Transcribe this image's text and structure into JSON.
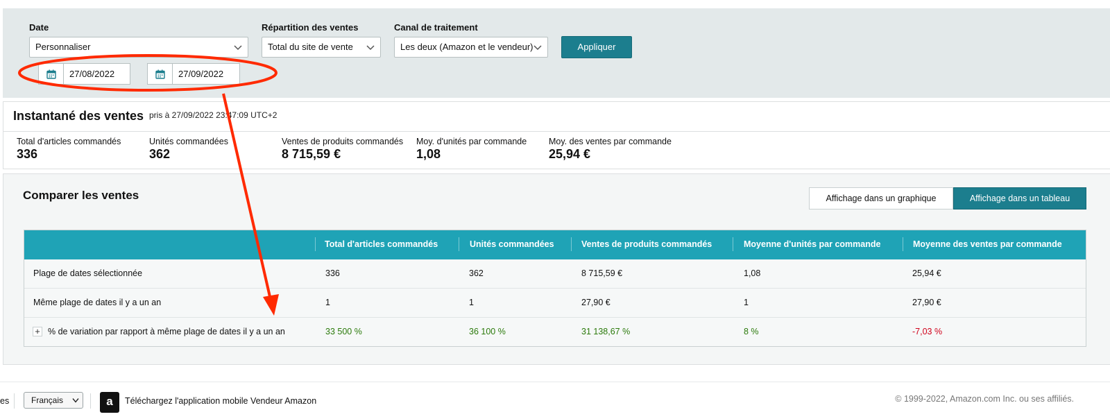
{
  "filters": {
    "date_label": "Date",
    "date_value": "Personnaliser",
    "repartition_label": "Répartition des ventes",
    "repartition_value": "Total du site de vente",
    "canal_label": "Canal de traitement",
    "canal_value": "Les deux (Amazon et le vendeur)",
    "apply_label": "Appliquer",
    "start_date": "27/08/2022",
    "end_date": "27/09/2022"
  },
  "snapshot": {
    "title": "Instantané des ventes",
    "timestamp": "pris à 27/09/2022 23:47:09 UTC+2",
    "metrics": [
      {
        "label": "Total d'articles commandés",
        "value": "336"
      },
      {
        "label": "Unités commandées",
        "value": "362"
      },
      {
        "label": "Ventes de produits commandés",
        "value": "8 715,59 €"
      },
      {
        "label": "Moy. d'unités par commande",
        "value": "1,08"
      },
      {
        "label": "Moy. des ventes par commande",
        "value": "25,94 €"
      }
    ]
  },
  "compare": {
    "title": "Comparer les ventes",
    "view_graph_label": "Affichage dans un graphique",
    "view_table_label": "Affichage dans un tableau",
    "columns": [
      "",
      "Total d'articles commandés",
      "Unités commandées",
      "Ventes de produits commandés",
      "Moyenne d'unités par commande",
      "Moyenne des ventes par commande"
    ],
    "rows": [
      {
        "label": "Plage de dates sélectionnée",
        "cells": [
          "336",
          "362",
          "8 715,59 €",
          "1,08",
          "25,94 €"
        ]
      },
      {
        "label": "Même plage de dates il y a un an",
        "cells": [
          "1",
          "1",
          "27,90 €",
          "1",
          "27,90 €"
        ]
      },
      {
        "label": "% de variation par rapport à même plage de dates il y a un an",
        "cells": [
          "33 500 %",
          "36 100 %",
          "31 138,67 %",
          "8 %",
          "-7,03 %"
        ]
      }
    ],
    "expand_symbol": "+"
  },
  "footer": {
    "left_text": "es",
    "language": "Français",
    "app_icon_letter": "a",
    "app_text": "Téléchargez l'application mobile Vendeur Amazon",
    "copyright": "© 1999-2022, Amazon.com Inc. ou ses affiliés."
  },
  "colors": {
    "accent": "#1c7e8e",
    "table_header": "#1fa3b6",
    "positive": "#2b7a0b",
    "negative": "#d0021b",
    "annotation": "#ff2a00"
  }
}
